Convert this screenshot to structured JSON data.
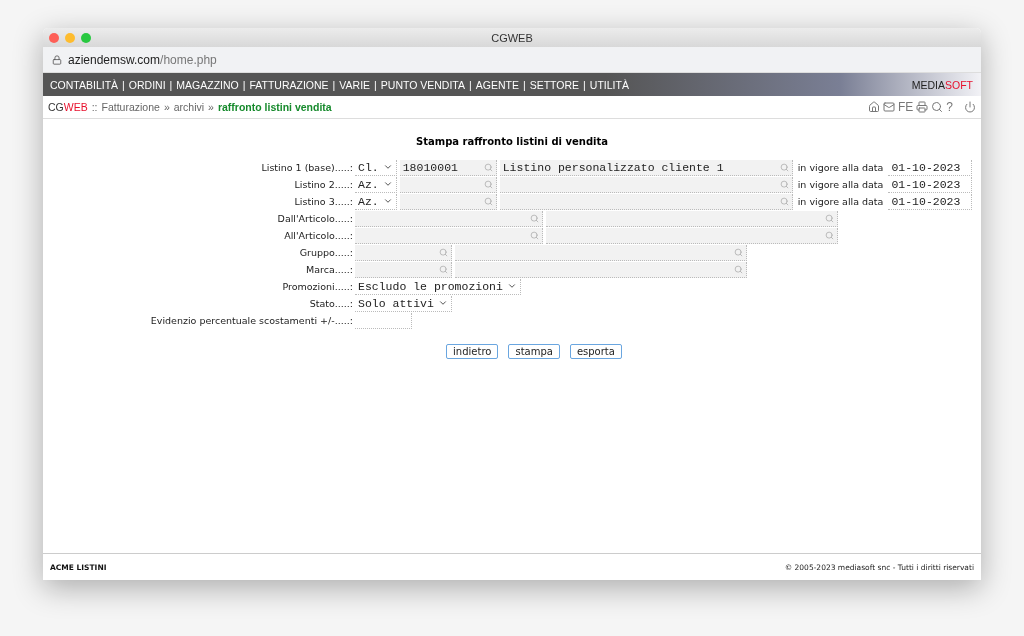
{
  "window": {
    "title": "CGWEB"
  },
  "address_bar": {
    "host": "aziendemsw.com",
    "path": "/home.php"
  },
  "nav": {
    "separator": "|",
    "items": [
      "CONTABILITÀ",
      "ORDINI",
      "MAGAZZINO",
      "FATTURAZIONE",
      "VARIE",
      "PUNTO VENDITA",
      "AGENTE",
      "SETTORE",
      "UTILITÀ"
    ],
    "brand": [
      "MEDIA",
      "SOFT"
    ]
  },
  "breadcrumb": [
    {
      "kind": "brand",
      "text": "CG"
    },
    {
      "kind": "brand_accent",
      "text": "WEB"
    },
    {
      "kind": "sep",
      "text": "::"
    },
    {
      "kind": "link",
      "text": "Fatturazione"
    },
    {
      "kind": "sep",
      "text": "»"
    },
    {
      "kind": "link",
      "text": "archivi"
    },
    {
      "kind": "sep",
      "text": "»"
    },
    {
      "kind": "current",
      "text": "raffronto listini vendita"
    }
  ],
  "toolbar": [
    {
      "kind": "home"
    },
    {
      "kind": "mail"
    },
    {
      "kind": "text",
      "text": "FE"
    },
    {
      "kind": "print"
    },
    {
      "kind": "search"
    },
    {
      "kind": "text",
      "text": "?"
    },
    {
      "kind": "power"
    }
  ],
  "form": {
    "title": "Stampa raffronto listini di vendita",
    "rows": [
      {
        "kind": "listino",
        "label": "Listino 1 (base).....:",
        "type": "Cl.",
        "code": "18010001",
        "description": "Listino personalizzato cliente 1",
        "date_label": "in vigore alla data",
        "date": "01-10-2023"
      },
      {
        "kind": "listino",
        "label": "Listino 2.....:",
        "type": "Az.",
        "date_label": "in vigore alla data",
        "date": "01-10-2023"
      },
      {
        "kind": "listino",
        "label": "Listino 3.....:",
        "type": "Az.",
        "date_label": "in vigore alla data",
        "date": "01-10-2023"
      },
      {
        "kind": "article",
        "label": "Dall'Articolo.....:"
      },
      {
        "kind": "article",
        "label": "All'Articolo.....:"
      },
      {
        "kind": "group",
        "label": "Gruppo.....:"
      },
      {
        "kind": "group",
        "label": "Marca.....:"
      },
      {
        "kind": "select",
        "label": "Promozioni.....:",
        "value": "Escludo le promozioni"
      },
      {
        "kind": "select",
        "label": "Stato.....:",
        "value": "Solo attivi"
      },
      {
        "kind": "text",
        "label": "Evidenzio percentuale scostamenti +/-.....:"
      }
    ],
    "buttons": [
      "indietro",
      "stampa",
      "esporta"
    ]
  },
  "footer": {
    "left": "ACME LISTINI",
    "right": "© 2005-2023 mediasoft snc - Tutti i diritti riservati"
  }
}
